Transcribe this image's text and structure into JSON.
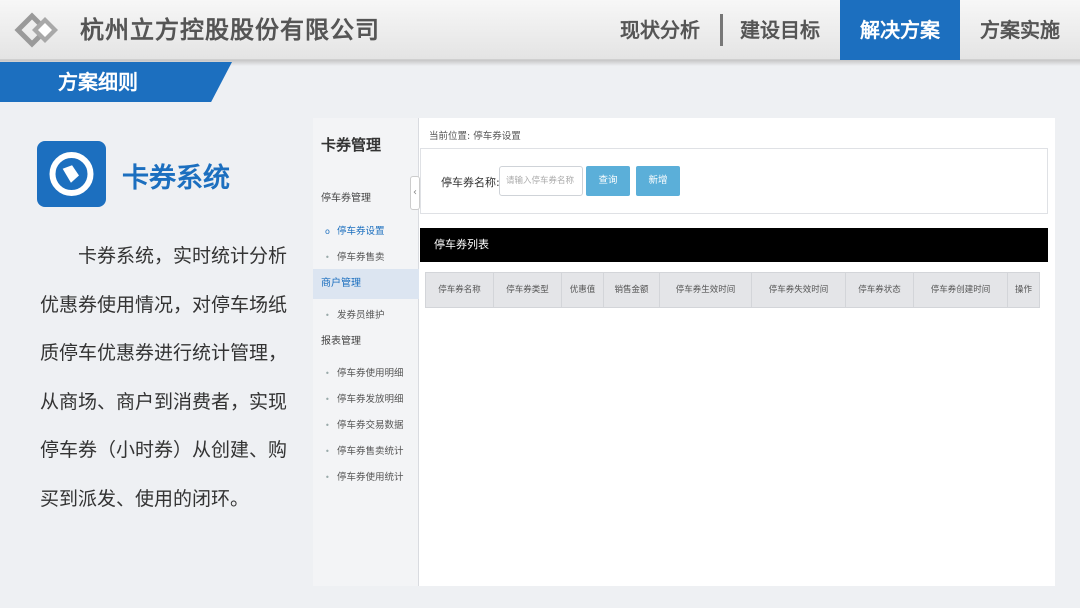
{
  "header": {
    "company": "杭州立方控股股份有限公司",
    "nav": [
      {
        "label": "现状分析"
      },
      {
        "label": "建设目标"
      },
      {
        "label": "解决方案",
        "active": true
      },
      {
        "label": "方案实施"
      }
    ]
  },
  "section": {
    "label": "方案细则"
  },
  "feature": {
    "title": "卡券系统",
    "icon": "coupon-tag-icon",
    "description": "卡券系统，实时统计分析优惠券使用情况，对停车场纸质停车优惠券进行统计管理，从商场、商户到消费者，实现停车券（小时券）从创建、购买到派发、使用的闭环。"
  },
  "app": {
    "sidebar": {
      "title": "卡券管理",
      "groups": [
        {
          "label": "停车券管理",
          "items": [
            {
              "label": "停车券设置",
              "active": true
            },
            {
              "label": "停车券售卖"
            }
          ]
        },
        {
          "label": "商户管理",
          "selected": true,
          "items": [
            {
              "label": "发券员维护"
            }
          ]
        },
        {
          "label": "报表管理",
          "items": [
            {
              "label": "停车券使用明细"
            },
            {
              "label": "停车券发放明细"
            },
            {
              "label": "停车券交易数据"
            },
            {
              "label": "停车券售卖统计"
            },
            {
              "label": "停车券使用统计"
            }
          ]
        }
      ]
    },
    "breadcrumb": "当前位置: 停车券设置",
    "search": {
      "label": "停车券名称:",
      "placeholder": "请输入停车券名称",
      "query_button": "查询",
      "add_button": "新增"
    },
    "list": {
      "title": "停车券列表",
      "columns": [
        "停车券名称",
        "停车券类型",
        "优惠值",
        "销售金额",
        "停车券生效时间",
        "停车券失效时间",
        "停车券状态",
        "停车券创建时间",
        "操作"
      ]
    }
  },
  "colors": {
    "accent": "#1c6fbf",
    "button": "#5bafd9"
  }
}
